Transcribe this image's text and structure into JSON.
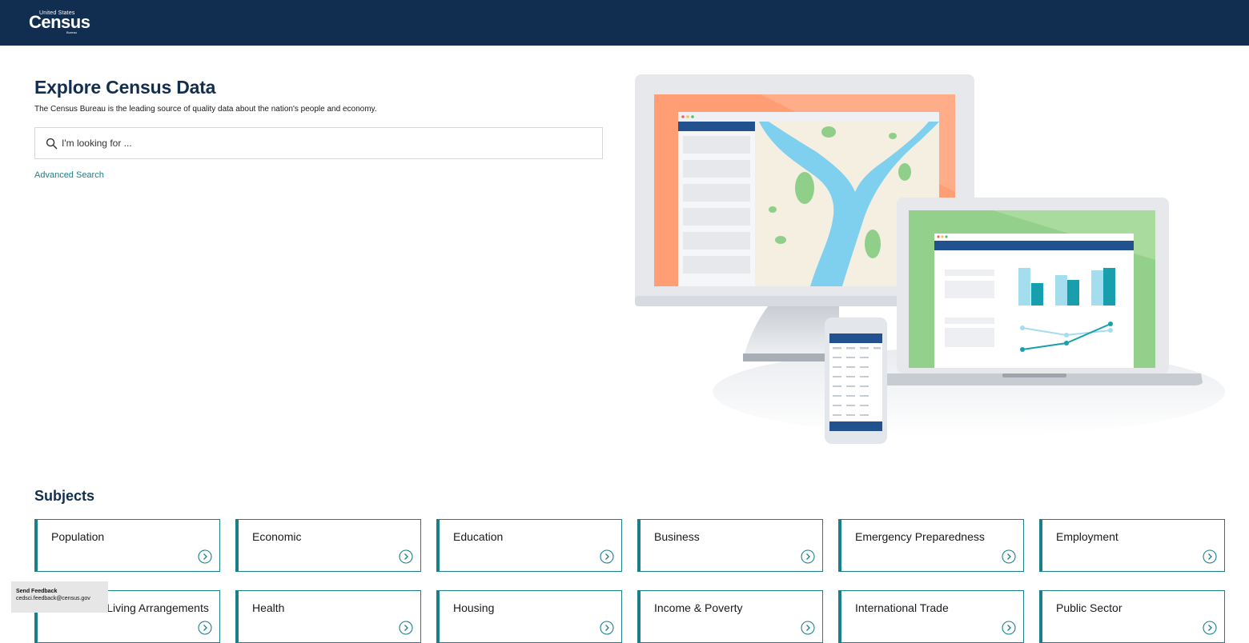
{
  "header": {
    "logo_top": "United States",
    "logo_main": "Census",
    "logo_bottom": "Bureau",
    "background": "#112e51"
  },
  "hero": {
    "title": "Explore Census Data",
    "subtitle": "The Census Bureau is the leading source of quality data about the nation's people and economy.",
    "search_placeholder": "I'm looking for ...",
    "search_icon": "search-icon",
    "advanced_search": "Advanced Search"
  },
  "subjects": {
    "title": "Subjects",
    "arrow_icon": "chevron-right-circle-icon",
    "accent": "#1b7f8a",
    "items": [
      {
        "label": "Population"
      },
      {
        "label": "Economic"
      },
      {
        "label": "Education"
      },
      {
        "label": "Business"
      },
      {
        "label": "Emergency Preparedness"
      },
      {
        "label": "Employment"
      },
      {
        "label": "Families & Living Arrangements"
      },
      {
        "label": "Health"
      },
      {
        "label": "Housing"
      },
      {
        "label": "Income & Poverty"
      },
      {
        "label": "International Trade"
      },
      {
        "label": "Public Sector"
      }
    ]
  },
  "feedback": {
    "title": "Send Feedback",
    "email": "cedsci.feedback@census.gov"
  }
}
